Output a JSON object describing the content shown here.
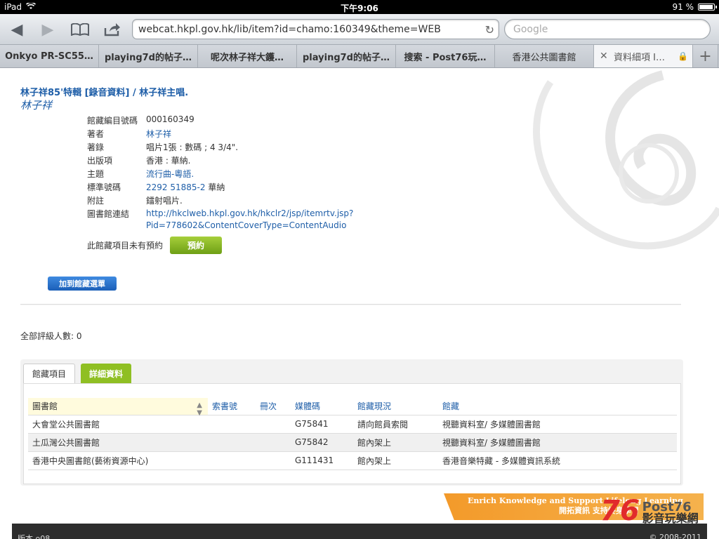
{
  "status": {
    "device": "iPad",
    "time": "下午9:06",
    "battery": "91 %"
  },
  "browser": {
    "url": "webcat.hkpl.gov.hk/lib/item?id=chamo:160349&theme=WEB",
    "search_placeholder": "Google",
    "tabs": [
      {
        "label": "Onkyo PR-SC55…"
      },
      {
        "label": "playing7d的帖子…"
      },
      {
        "label": "呢次林子祥大鑊…"
      },
      {
        "label": "playing7d的帖子…"
      },
      {
        "label": "搜索 - Post76玩…"
      },
      {
        "label": "香港公共圖書館"
      },
      {
        "label": "資料細項 I…",
        "active": true
      }
    ]
  },
  "record": {
    "title": "林子祥85'特輯 [錄音資料] / 林子祥主唱.",
    "author": "林子祥",
    "fields": [
      {
        "key": "館藏編目號碼",
        "value": "000160349"
      },
      {
        "key": "著者",
        "value": "林子祥"
      },
      {
        "key": "著錄",
        "value": "唱片1張 : 數碼 ; 4 3/4\"."
      },
      {
        "key": "出版項",
        "value": "香港 : 華納."
      },
      {
        "key": "主題",
        "value": "流行曲-粵語."
      },
      {
        "key": "標準號碼",
        "value": "2292 51885-2",
        "value2": " 華納"
      },
      {
        "key": "附註",
        "value": "鐳射唱片."
      },
      {
        "key": "圖書館連結",
        "value": "http://hkclweb.hkpl.gov.hk/hkclr2/jsp/itemrtv.jsp?",
        "value2": "Pid=778602&ContentCoverType=ContentAudio"
      }
    ],
    "reserve_note": "此館藏項目未有預約",
    "reserve_label": "預約",
    "add_list_label": "加到館藏選單",
    "rating_text": "全部評級人數: 0"
  },
  "holdings": {
    "tabs": [
      "館藏項目",
      "詳細資料"
    ],
    "columns": [
      "圖書館",
      "索書號",
      "冊次",
      "媒體碼",
      "館藏現況",
      "館藏"
    ],
    "rows": [
      [
        "大會堂公共圖書館",
        "",
        "",
        "G75841",
        "請向館員索閱",
        "視聽資料室/ 多媒體圖書館"
      ],
      [
        "土瓜灣公共圖書館",
        "",
        "",
        "G75842",
        "館內架上",
        "視聽資料室/ 多媒體圖書館"
      ],
      [
        "香港中央圖書館(藝術資源中心)",
        "",
        "",
        "G111431",
        "館內架上",
        "香港音樂特藏 - 多媒體資訊系統"
      ]
    ]
  },
  "footer": {
    "banner_en": "Enrich Knowledge and Support Lifelong Learning",
    "banner_zh": "開拓資訊 支持終身學習",
    "logo_num": "76",
    "logo_text": "Post76",
    "logo_sub": "影音玩樂網",
    "version": "版本 o08",
    "copyright": "© 2008-2011"
  }
}
